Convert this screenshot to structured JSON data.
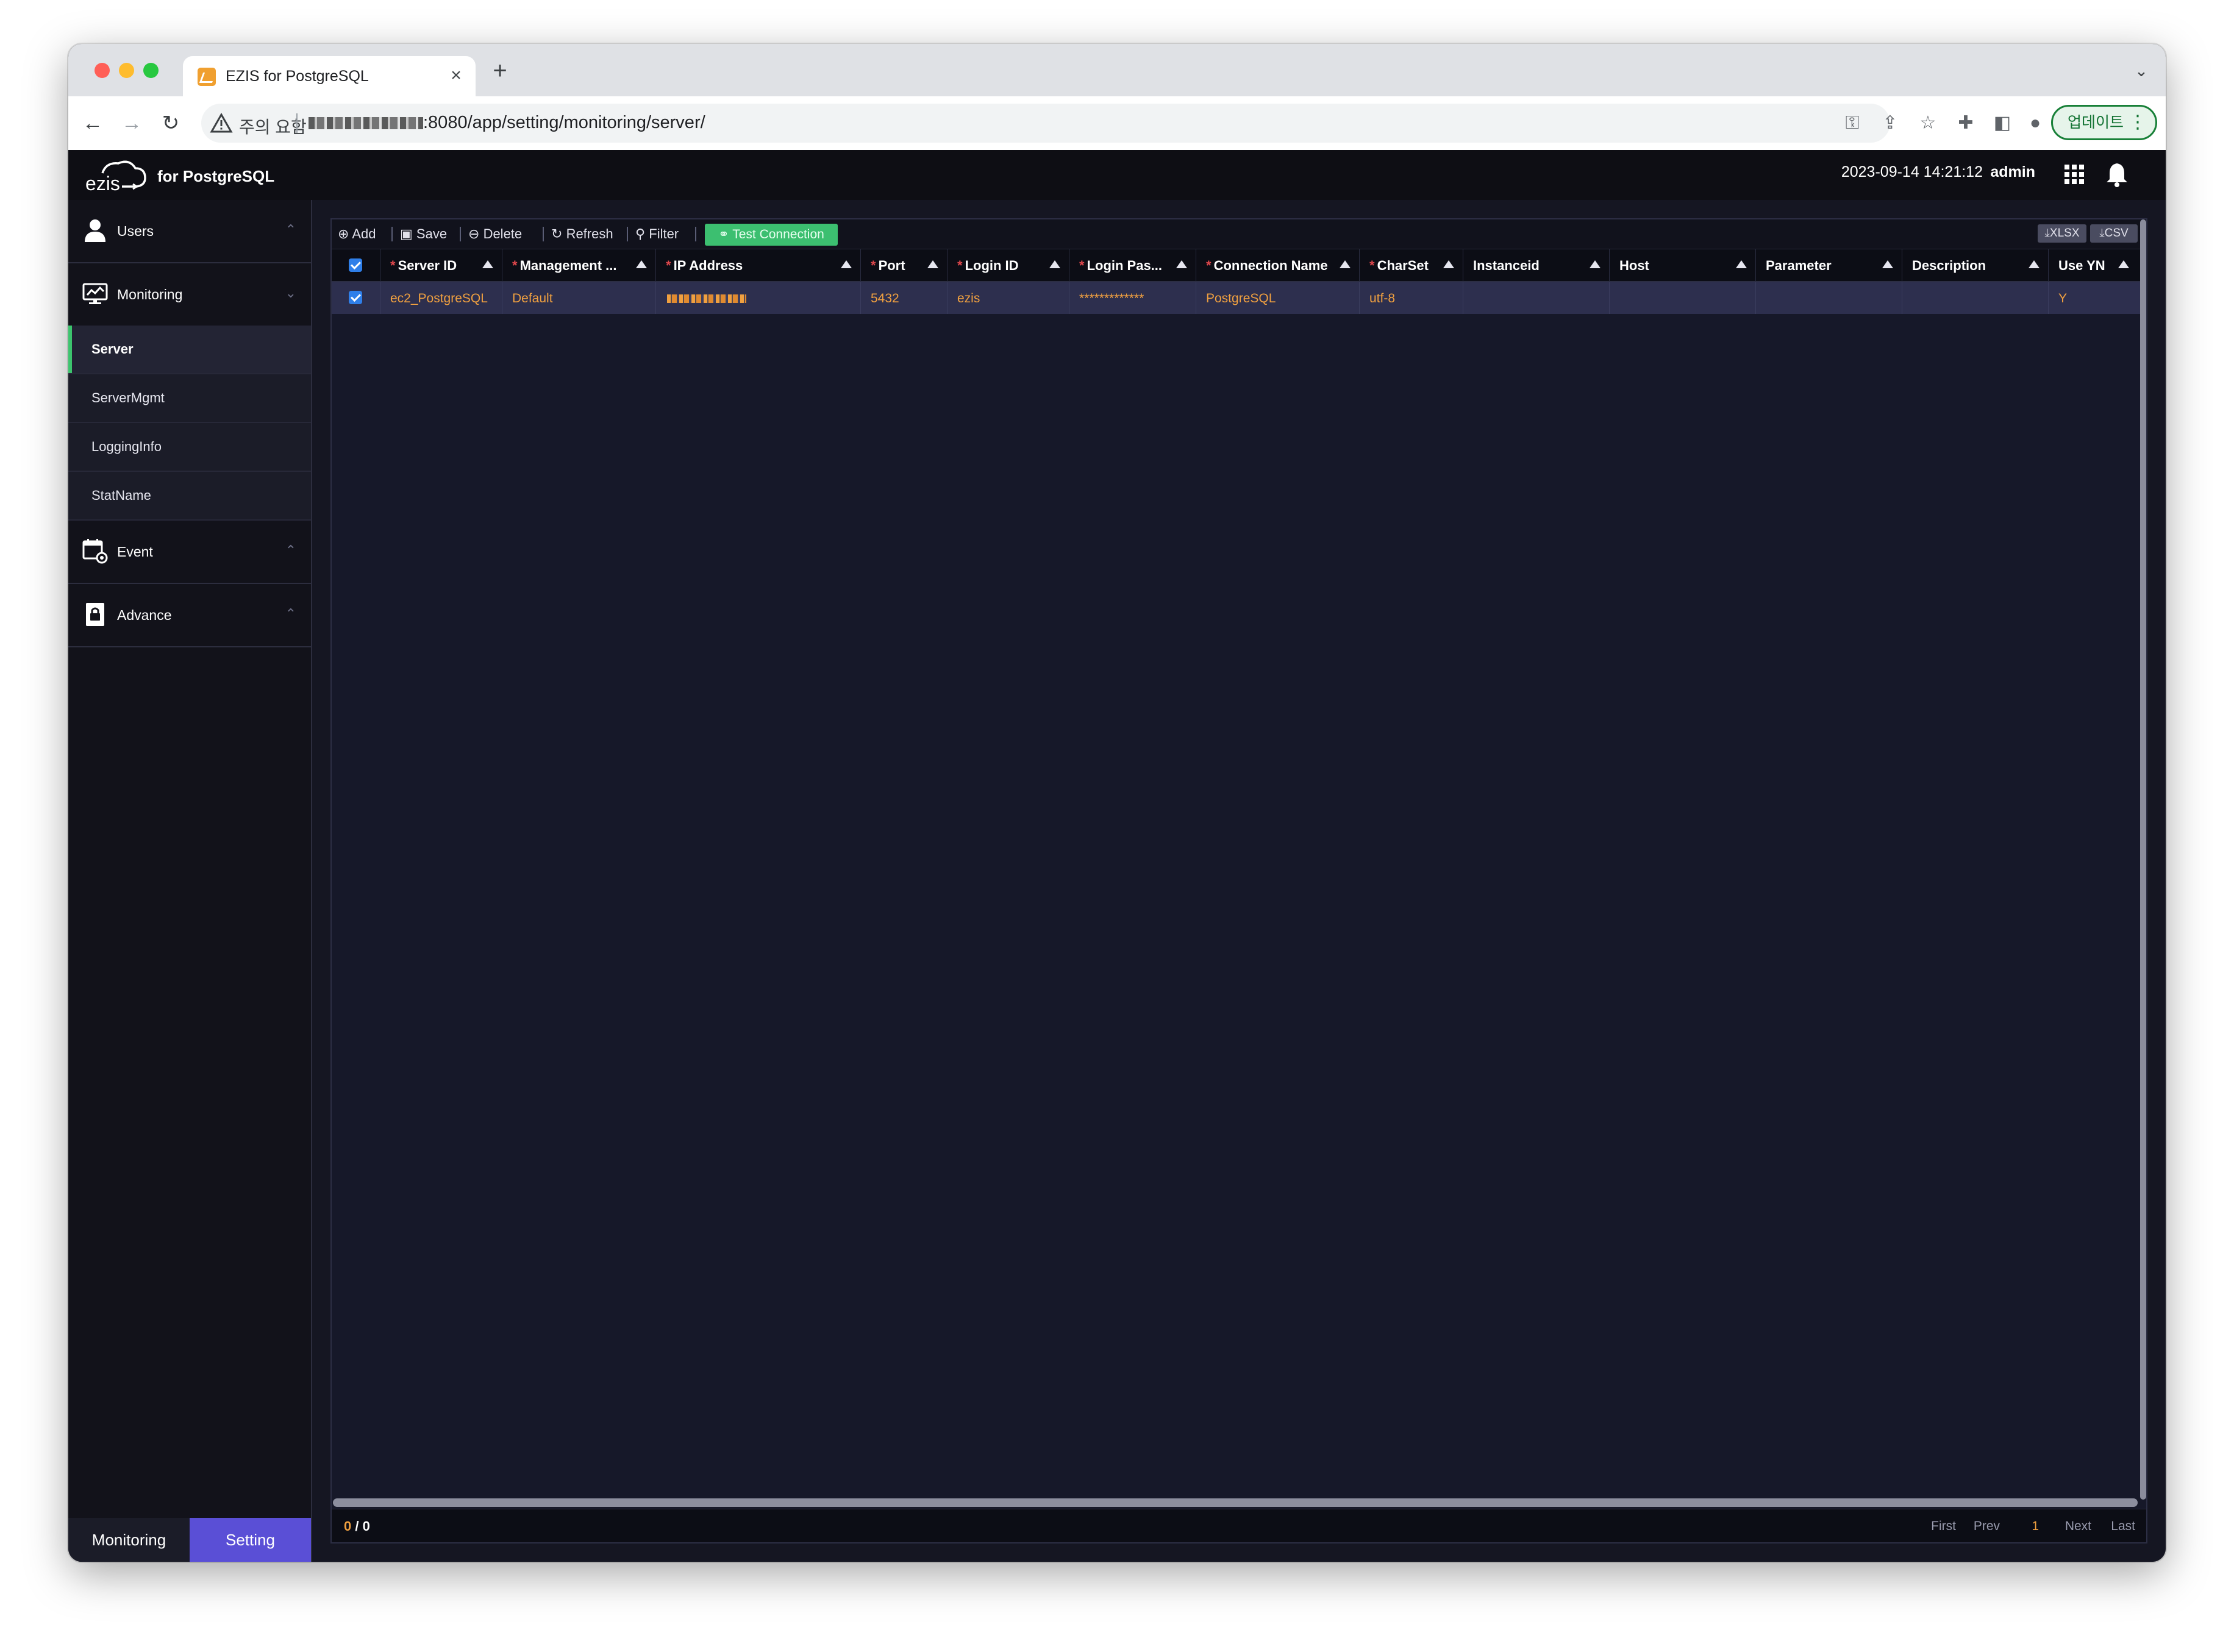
{
  "browser": {
    "tab_title": "EZIS for PostgreSQL",
    "tab_close": "×",
    "new_tab": "+",
    "security_warning": "주의 요함",
    "url": ":8080/app/setting/monitoring/server/",
    "update_label": "업데이트",
    "update_menu": "⋮"
  },
  "app": {
    "logo_text": "ezis",
    "logo_sub": "for PostgreSQL",
    "datetime": "2023-09-14 14:21:12",
    "user": "admin"
  },
  "sidebar": {
    "groups": [
      {
        "label": "Users",
        "icon": "user-icon"
      },
      {
        "label": "Monitoring",
        "icon": "monitor-icon"
      },
      {
        "label": "Event",
        "icon": "calendar-gear-icon"
      },
      {
        "label": "Advance",
        "icon": "lock-doc-icon"
      }
    ],
    "monitoring_items": [
      {
        "label": "Server",
        "active": true
      },
      {
        "label": "ServerMgmt"
      },
      {
        "label": "LoggingInfo"
      },
      {
        "label": "StatName"
      }
    ],
    "bottom_tabs": {
      "monitoring": "Monitoring",
      "setting": "Setting"
    }
  },
  "grid": {
    "toolbar": {
      "add": "Add",
      "save": "Save",
      "delete": "Delete",
      "refresh": "Refresh",
      "filter": "Filter",
      "test_connection": "Test Connection",
      "xlsx": "XLSX",
      "csv": "CSV"
    },
    "columns": [
      {
        "label": "Server ID",
        "required": true
      },
      {
        "label": "Management ...",
        "required": true
      },
      {
        "label": "IP Address",
        "required": true
      },
      {
        "label": "Port",
        "required": true
      },
      {
        "label": "Login ID",
        "required": true
      },
      {
        "label": "Login Pas...",
        "required": true
      },
      {
        "label": "Connection Name",
        "required": true
      },
      {
        "label": "CharSet",
        "required": true
      },
      {
        "label": "Instanceid",
        "required": false
      },
      {
        "label": "Host",
        "required": false
      },
      {
        "label": "Parameter",
        "required": false
      },
      {
        "label": "Description",
        "required": false
      },
      {
        "label": "Use YN",
        "required": false
      }
    ],
    "rows": [
      {
        "checked": true,
        "server_id": "ec2_PostgreSQL",
        "management": "Default",
        "ip_address": "",
        "port": "5432",
        "login_id": "ezis",
        "login_password": "*************",
        "connection_name": "PostgreSQL",
        "charset": "utf-8",
        "instanceid": "",
        "host": "",
        "parameter": "",
        "description": "",
        "use_yn": "Y"
      }
    ],
    "footer": {
      "count_current": "0",
      "count_sep": " / ",
      "count_total": "0",
      "first": "First",
      "prev": "Prev",
      "page": "1",
      "next": "Next",
      "last": "Last"
    }
  },
  "colors": {
    "accent_green": "#3cc46d",
    "setting_purple": "#5a4fd6",
    "value_orange": "#f0a040"
  }
}
